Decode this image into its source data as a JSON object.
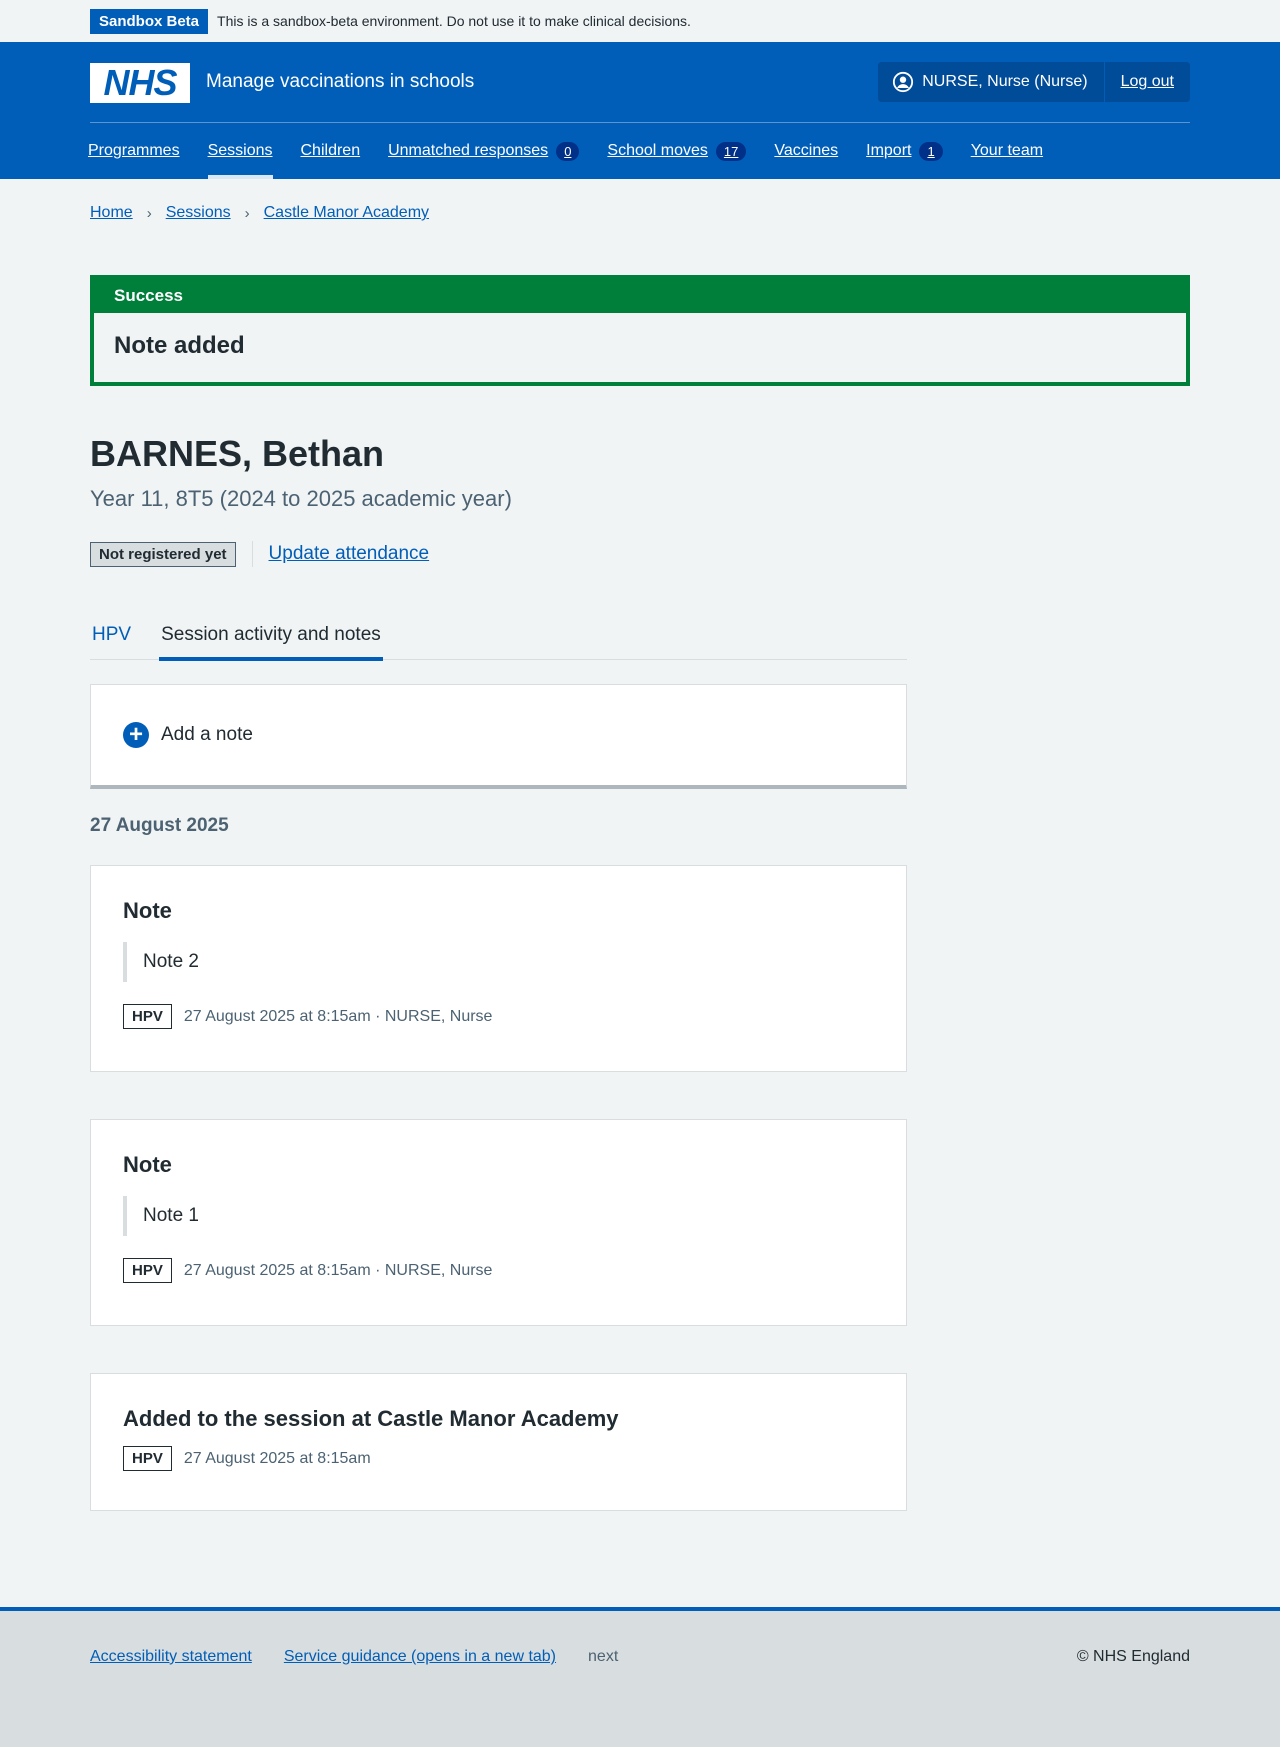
{
  "sandbox": {
    "tag": "Sandbox Beta",
    "message": "This is a sandbox-beta environment. Do not use it to make clinical decisions."
  },
  "header": {
    "logo_text": "NHS",
    "service_name": "Manage vaccinations in schools",
    "user": "NURSE, Nurse (Nurse)",
    "logout": "Log out"
  },
  "nav": {
    "programmes": "Programmes",
    "sessions": "Sessions",
    "children": "Children",
    "unmatched": "Unmatched responses",
    "unmatched_count": "0",
    "school_moves": "School moves",
    "school_moves_count": "17",
    "vaccines": "Vaccines",
    "import": "Import",
    "import_count": "1",
    "your_team": "Your team"
  },
  "breadcrumb": {
    "home": "Home",
    "sessions": "Sessions",
    "school": "Castle Manor Academy"
  },
  "success": {
    "heading": "Success",
    "message": "Note added"
  },
  "person": {
    "name": "BARNES, Bethan",
    "details": "Year 11, 8T5 (2024 to 2025 academic year)",
    "status": "Not registered yet",
    "update_link": "Update attendance"
  },
  "tabs": {
    "hpv": "HPV",
    "activity": "Session activity and notes"
  },
  "add_note": {
    "label": "Add a note"
  },
  "date_heading": "27 August 2025",
  "cards": [
    {
      "title": "Note",
      "quote": "Note 2",
      "tag": "HPV",
      "meta": "27 August 2025 at 8:15am · NURSE, Nurse"
    },
    {
      "title": "Note",
      "quote": "Note 1",
      "tag": "HPV",
      "meta": "27 August 2025 at 8:15am · NURSE, Nurse"
    },
    {
      "title": "Added to the session at Castle Manor Academy",
      "tag": "HPV",
      "meta": "27 August 2025 at 8:15am"
    }
  ],
  "footer": {
    "accessibility": "Accessibility statement",
    "guidance": "Service guidance (opens in a new tab)",
    "version": "next",
    "copyright": "© NHS England"
  },
  "colors": {
    "nhs_blue": "#005eb8",
    "success_green": "#007f3b",
    "background": "#f0f4f5",
    "text": "#212b32",
    "secondary_text": "#4c6272"
  }
}
